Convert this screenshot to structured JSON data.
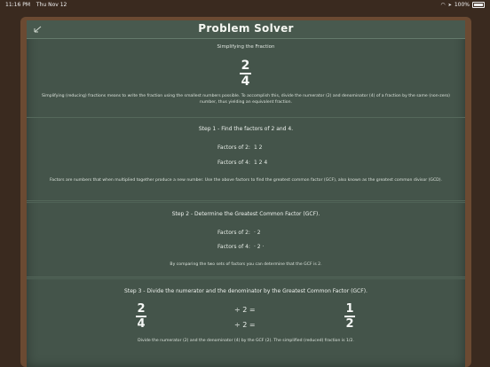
{
  "status": {
    "time": "11:16 PM",
    "date": "Thu Nov 12",
    "battery": "100%"
  },
  "header": {
    "title": "Problem Solver"
  },
  "subtitle": "Simplifying the Fraction",
  "fraction": {
    "numerator": "2",
    "denominator": "4"
  },
  "intro": "Simplifying (reducing) fractions means to write the fraction using the smallest numbers possible. To accomplish this, divide the numerator (2) and denominator (4) of a fraction by the same (non-zero) number, thus yielding an equivalent fraction.",
  "step1": {
    "title": "Step 1 - Find the factors of 2 and 4.",
    "row1_label": "Factors of 2:",
    "row1_values": "1 2",
    "row2_label": "Factors of 4:",
    "row2_values": "1 2 4",
    "note": "Factors are numbers that when multiplied together produce a new number. Use the above factors to find the greatest common factor (GCF), also known as the greatest common divisor (GCD)."
  },
  "step2": {
    "title": "Step 2 - Determine the Greatest Common Factor (GCF).",
    "row1_label": "Factors of 2:",
    "row1_values": "· 2",
    "row2_label": "Factors of 4:",
    "row2_values": "· 2 ·",
    "note": "By comparing the two sets of factors you can determine that the GCF is 2."
  },
  "step3": {
    "title": "Step 3 - Divide the numerator and the denominator by the Greatest Common Factor (GCF).",
    "left_num": "2",
    "left_den": "4",
    "div_top": "÷ 2 =",
    "div_bottom": "÷ 2 =",
    "result_num": "1",
    "result_den": "2",
    "note": "Divide the numerator (2) and the denominator (4) by the GCF (2). The simplified (reduced) fraction is 1/2."
  }
}
